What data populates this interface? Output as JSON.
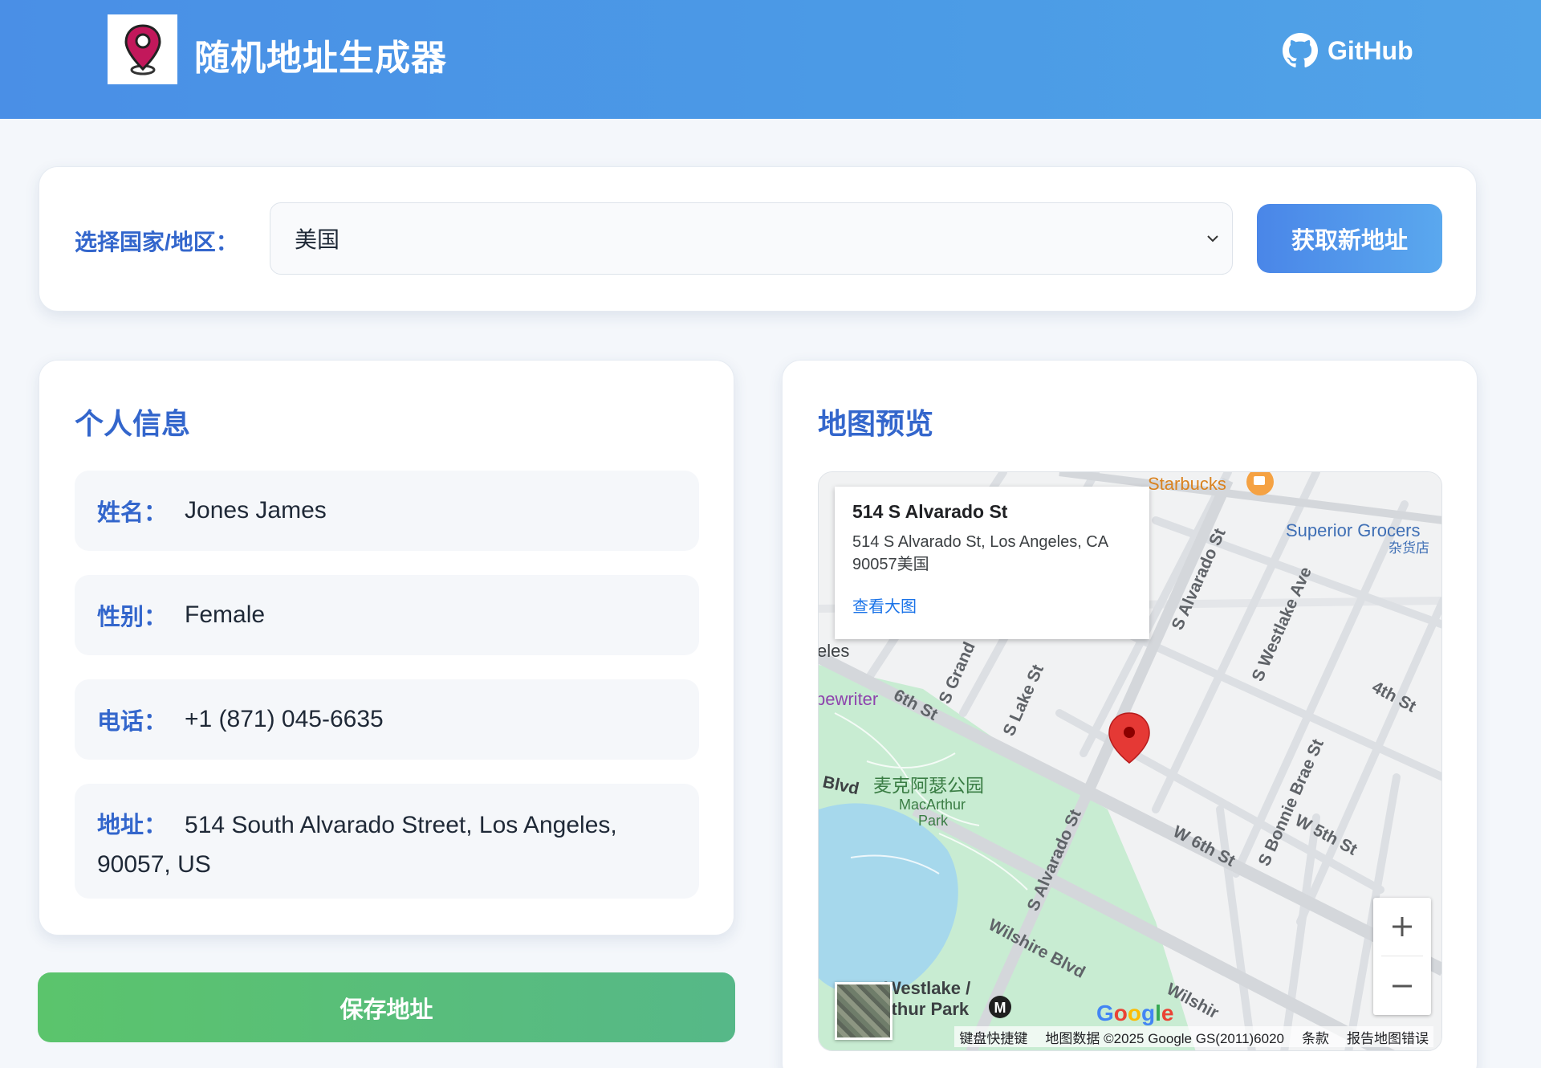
{
  "header": {
    "title": "随机地址生成器",
    "github_label": "GitHub"
  },
  "selector": {
    "label": "选择国家/地区：",
    "selected_country": "美国",
    "fetch_button": "获取新地址"
  },
  "personal_info": {
    "title": "个人信息",
    "fields": [
      {
        "label": "姓名：",
        "value": "Jones James"
      },
      {
        "label": "性别：",
        "value": "Female"
      },
      {
        "label": "电话：",
        "value": "+1 (871) 045-6635"
      },
      {
        "label": "地址：",
        "value": "514 South Alvarado Street, Los Angeles, 90057, US"
      }
    ],
    "save_button": "保存地址"
  },
  "map": {
    "title": "地图预览",
    "popup": {
      "title": "514 S Alvarado St",
      "address": "514 S Alvarado St, Los Angeles, CA 90057美国",
      "link": "查看大图"
    },
    "labels": {
      "starbucks": "Starbucks",
      "superior": "Superior Grocers",
      "superior_sub": "杂货店",
      "alvarado_top": "S Alvarado St",
      "westlake_ave": "S Westlake Ave",
      "fourth_st": "4th St",
      "grand": "S Grand",
      "lake_st": "S Lake St",
      "sixth_st": "6th St",
      "typewriter": "pewriter",
      "eles": "eles",
      "park_zh": "麦克阿瑟公园",
      "park_en1": "MacArthur",
      "park_en2": "Park",
      "blvd": "Blvd",
      "alvarado_bottom": "S Alvarado St",
      "w6th": "W 6th St",
      "bonnie": "S Bonnie Brae St",
      "w5th": "W 5th St",
      "wilshire": "Wilshire Blvd",
      "westlake_station1": "Westlake /",
      "westlake_station2": "rthur Park",
      "wilshire2": "Wilshir"
    },
    "footer": {
      "shortcuts": "键盘快捷键",
      "data": "地图数据 ©2025 Google GS(2011)6020",
      "terms": "条款",
      "report": "报告地图错误"
    },
    "google_letters": [
      "G",
      "o",
      "o",
      "g",
      "l",
      "e"
    ]
  },
  "colors": {
    "accent": "#3366cc",
    "header_bg": "#4a8fe6",
    "save_green": "#5bc46c",
    "pin_red": "#e53935"
  }
}
